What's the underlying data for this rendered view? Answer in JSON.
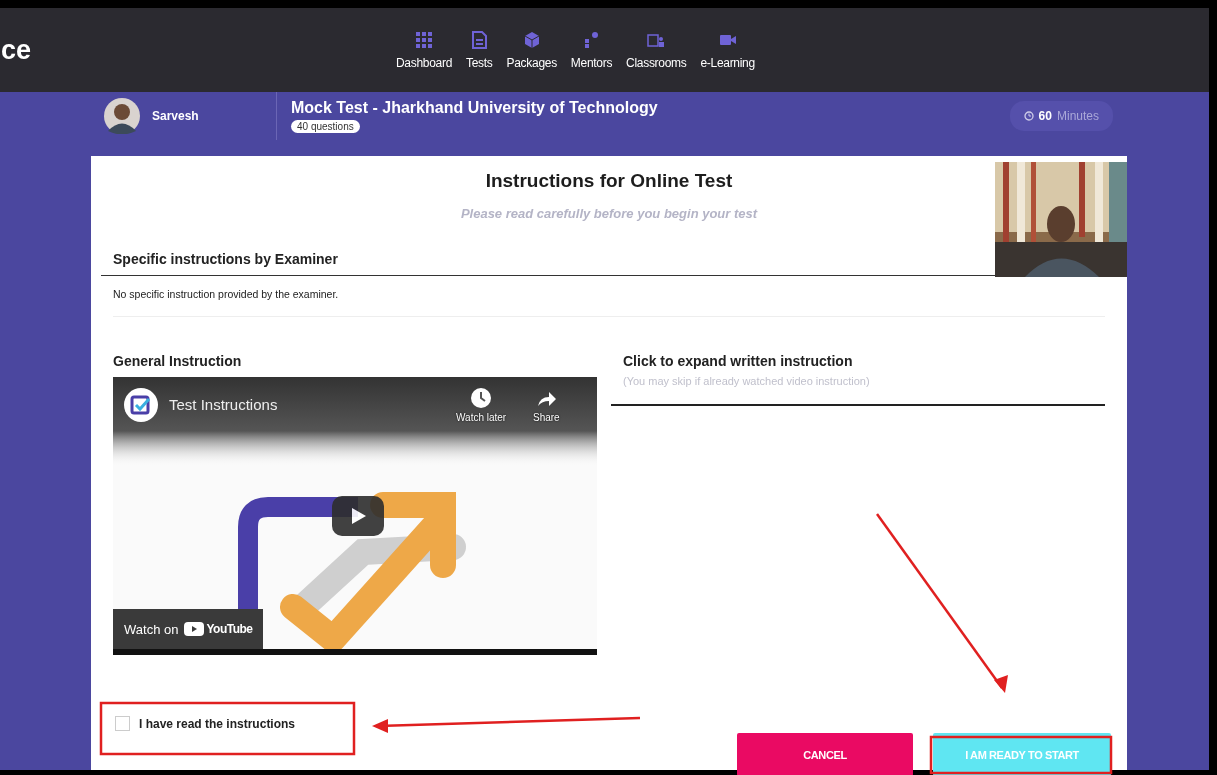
{
  "brand": {
    "text": "ce"
  },
  "nav": [
    {
      "label": "Dashboard",
      "kind": "grid"
    },
    {
      "label": "Tests",
      "kind": "doc"
    },
    {
      "label": "Packages",
      "kind": "box"
    },
    {
      "label": "Mentors",
      "kind": "people"
    },
    {
      "label": "Classrooms",
      "kind": "board"
    },
    {
      "label": "e-Learning",
      "kind": "video"
    }
  ],
  "test_header": {
    "user": "Sarvesh",
    "title": "Mock Test - Jharkhand University of Technology",
    "questions": "40 questions",
    "timer": {
      "value": "60",
      "unit": "Minutes"
    }
  },
  "card": {
    "title": "Instructions for Online Test",
    "subtitle": "Please read carefully before you begin your test",
    "specific": {
      "heading": "Specific instructions by Examiner",
      "text": "No specific instruction provided by the examiner."
    },
    "general": {
      "heading": "General Instruction",
      "video": {
        "title": "Test Instructions",
        "actions": [
          {
            "label": "Watch later",
            "kind": "clock"
          },
          {
            "label": "Share",
            "kind": "share"
          }
        ],
        "watch_on": "Watch on",
        "brand": "YouTube"
      }
    },
    "written": {
      "heading": "Click to expand written instruction",
      "hint": "(You may skip if already watched video instruction)"
    },
    "agree": {
      "label": "I have read the instructions",
      "checked": false
    },
    "buttons": [
      {
        "label": "CANCEL",
        "kind": "cancel"
      },
      {
        "label": "I AM READY TO START",
        "kind": "start"
      }
    ]
  }
}
